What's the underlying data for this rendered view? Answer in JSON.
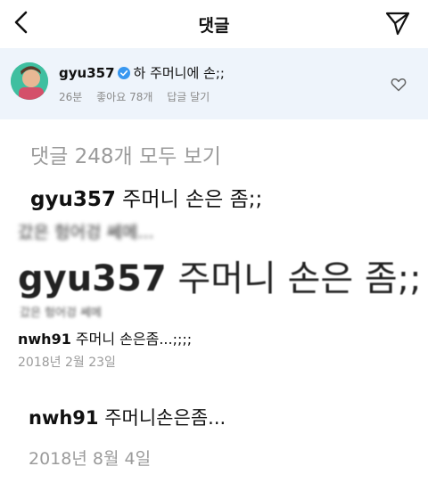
{
  "header": {
    "title": "댓글",
    "back_icon": "chevron-left-icon",
    "send_icon": "paper-plane-icon"
  },
  "caption": {
    "username": "gyu357",
    "verified_icon": "verified-badge-icon",
    "text": "하 주머니에 손;;",
    "time": "26분",
    "likes": "좋아요 78개",
    "reply": "답글 달기",
    "like_icon": "heart-icon"
  },
  "comments": {
    "view_all": "댓글 248개 모두 보기",
    "c1": {
      "username": "gyu357",
      "text": "주머니 손은 좀;;"
    },
    "blurred_line_1": "갔은 헝어겅 쎄메...",
    "c2": {
      "username": "gyu357",
      "text": "주머니 손은 좀;;"
    },
    "blurred_line_2": "갔은 헝어겅 쎄메",
    "c3": {
      "username": "nwh91",
      "text": "주머니 손은좀...;;;;",
      "date": "2018년 2월 23일"
    },
    "c4": {
      "username": "nwh91",
      "text": "주머니손은좀...",
      "date": "2018년 8월 4일"
    }
  },
  "colors": {
    "caption_bg": "#eef4fb",
    "verified_blue": "#3897f0",
    "muted_text": "#9b9b9b"
  }
}
